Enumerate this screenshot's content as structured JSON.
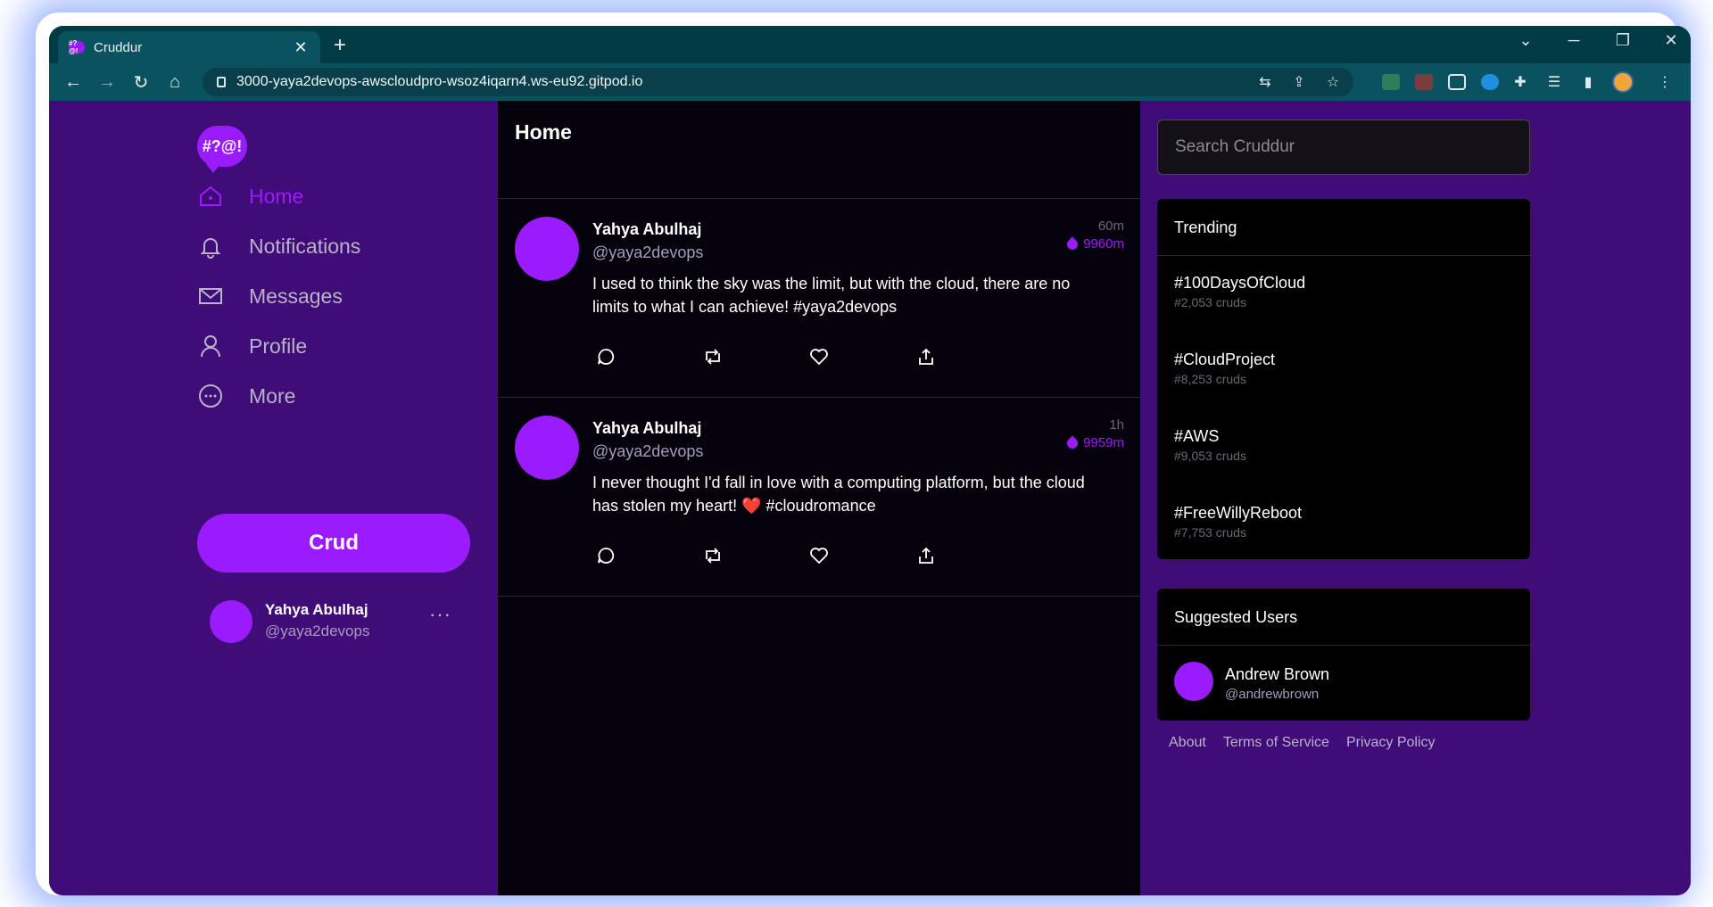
{
  "browser": {
    "tab_title": "Cruddur",
    "tab_favicon_text": "#?@!",
    "url": "3000-yaya2devops-awscloudpro-wsoz4iqarn4.ws-eu92.gitpod.io",
    "accent": "#003a45"
  },
  "app": {
    "brand_color": "#9b1bff",
    "logo_text": "#?@!"
  },
  "sidebar": {
    "items": [
      {
        "label": "Home",
        "icon": "home-icon",
        "active": true
      },
      {
        "label": "Notifications",
        "icon": "bell-icon",
        "active": false
      },
      {
        "label": "Messages",
        "icon": "envelope-icon",
        "active": false
      },
      {
        "label": "Profile",
        "icon": "person-icon",
        "active": false
      },
      {
        "label": "More",
        "icon": "more-circle-icon",
        "active": false
      }
    ],
    "crud_button": "Crud",
    "user": {
      "name": "Yahya Abulhaj",
      "handle": "@yaya2devops",
      "more": "···"
    }
  },
  "feed": {
    "title": "Home",
    "posts": [
      {
        "name": "Yahya Abulhaj",
        "handle": "@yaya2devops",
        "time": "60m",
        "expires": "9960m",
        "text": "I used to think the sky was the limit, but with the cloud, there are no limits to what I can achieve! #yaya2devops"
      },
      {
        "name": "Yahya Abulhaj",
        "handle": "@yaya2devops",
        "time": "1h",
        "expires": "9959m",
        "text_before": "I never thought I'd fall in love with a computing platform, but the cloud has stolen my heart! ",
        "emoji": "❤️",
        "text_after": " #cloudromance"
      }
    ]
  },
  "search": {
    "placeholder": "Search Cruddur"
  },
  "trending": {
    "title": "Trending",
    "items": [
      {
        "tag": "#100DaysOfCloud",
        "count": "#2,053 cruds"
      },
      {
        "tag": "#CloudProject",
        "count": "#8,253 cruds"
      },
      {
        "tag": "#AWS",
        "count": "#9,053 cruds"
      },
      {
        "tag": "#FreeWillyReboot",
        "count": "#7,753 cruds"
      }
    ]
  },
  "suggested": {
    "title": "Suggested Users",
    "users": [
      {
        "name": "Andrew Brown",
        "handle": "@andrewbrown"
      }
    ]
  },
  "footer": {
    "links": [
      "About",
      "Terms of Service",
      "Privacy Policy"
    ]
  }
}
